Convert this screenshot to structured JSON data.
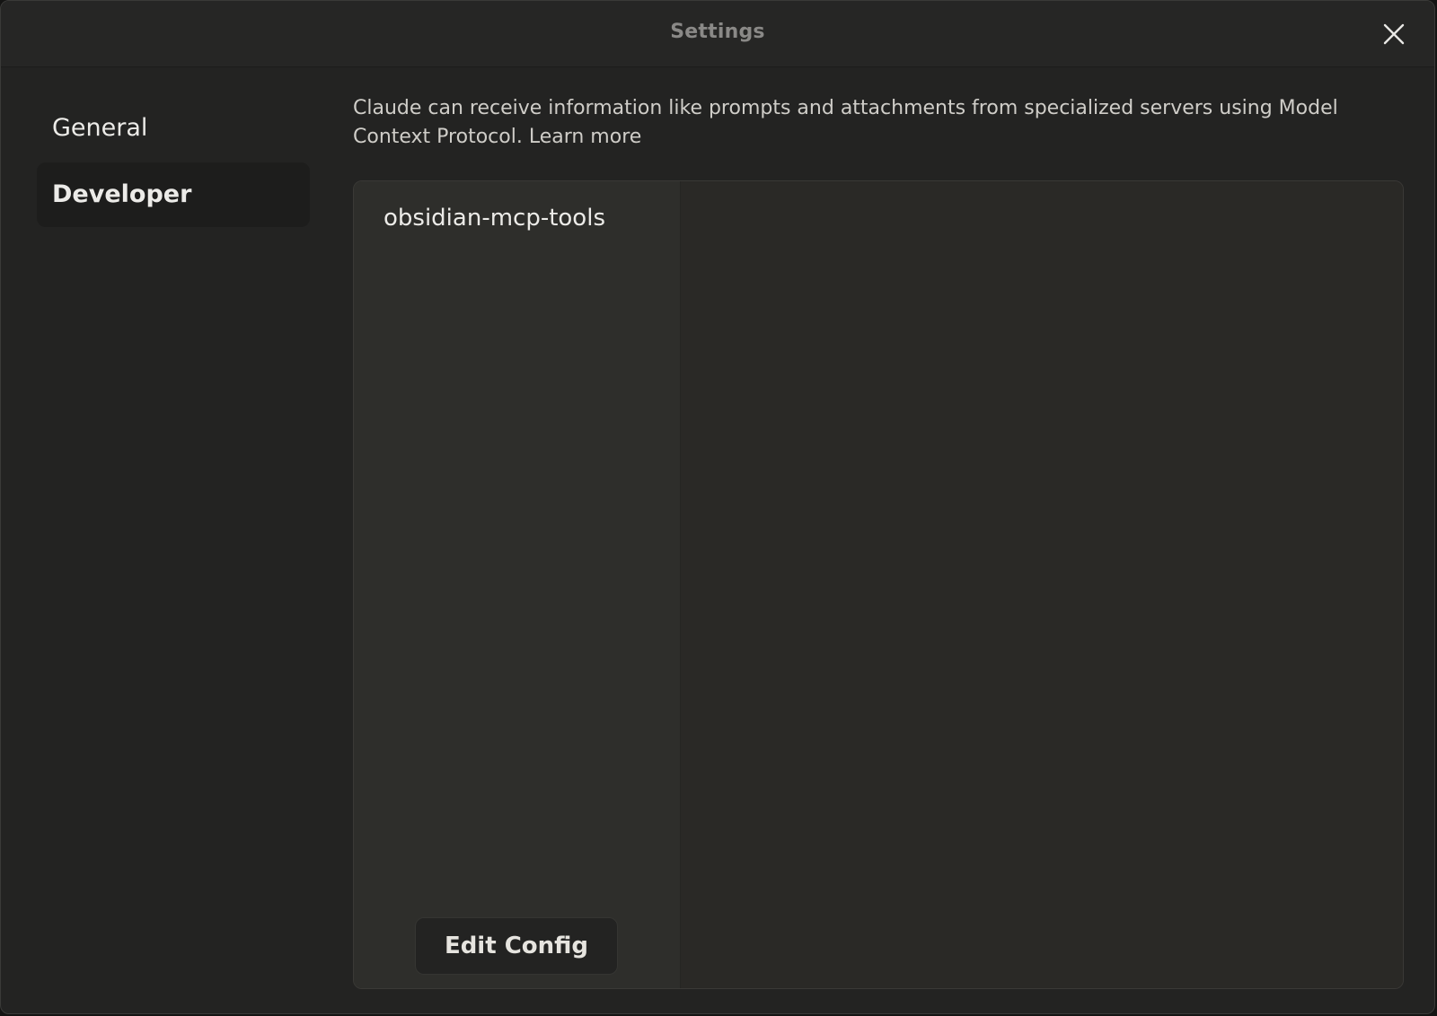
{
  "window": {
    "title": "Settings"
  },
  "sidebar": {
    "items": [
      {
        "label": "General",
        "active": false
      },
      {
        "label": "Developer",
        "active": true
      }
    ]
  },
  "main": {
    "description": "Claude can receive information like prompts and attachments from specialized servers using Model Context Protocol.",
    "learn_more_label": "Learn more",
    "servers": [
      {
        "name": "obsidian-mcp-tools"
      }
    ],
    "edit_config_label": "Edit Config"
  },
  "icons": {
    "close": "close-icon"
  },
  "colors": {
    "background": "#232322",
    "sidebar_active": "#1d1d1c",
    "server_list_bg": "#2e2e2b",
    "text_primary": "#ecebe8",
    "text_muted": "#8a8987"
  }
}
